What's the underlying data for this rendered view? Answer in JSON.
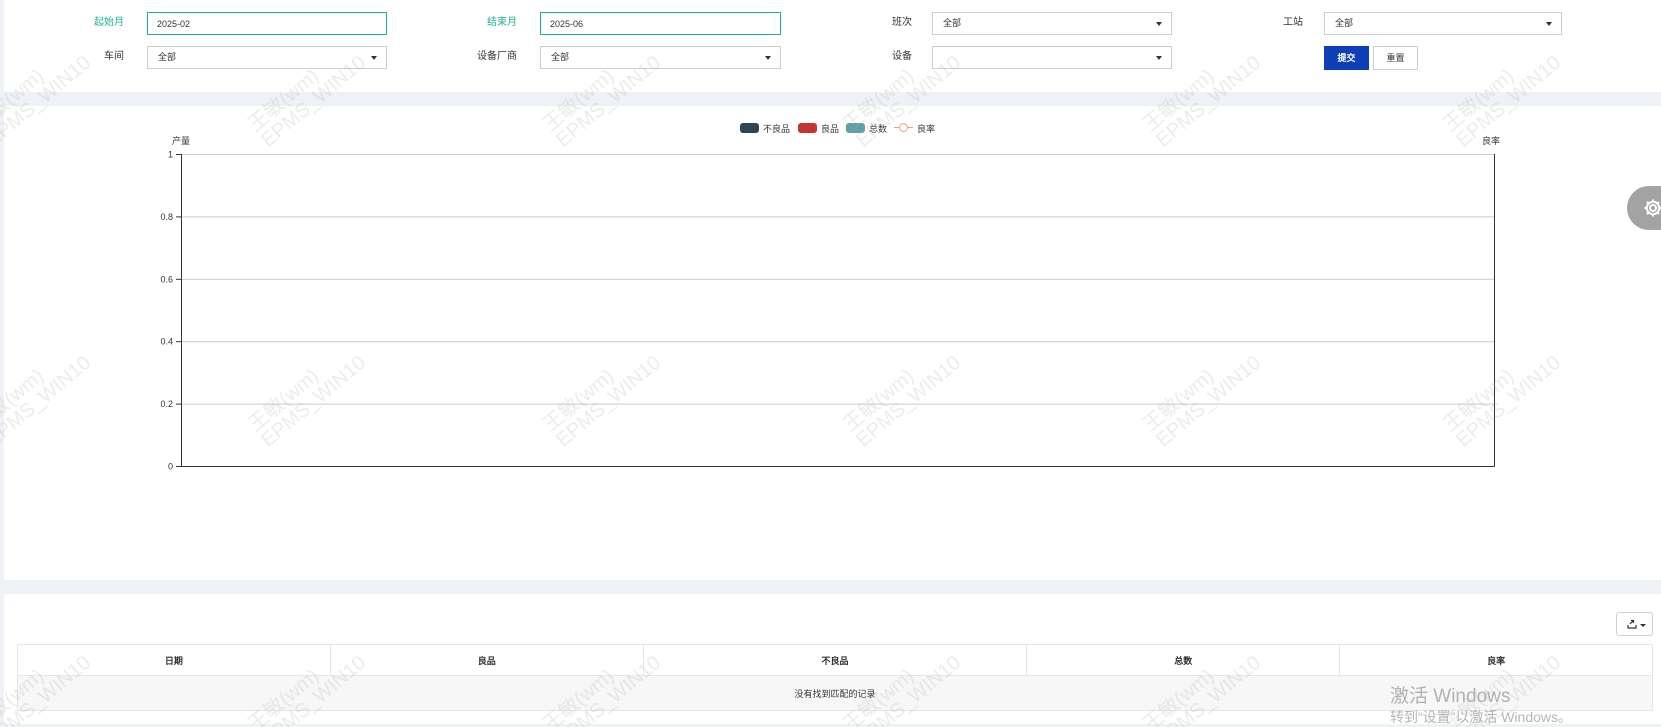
{
  "filters": {
    "start_month": {
      "label": "起始月",
      "value": "2025-02"
    },
    "end_month": {
      "label": "结束月",
      "value": "2025-06"
    },
    "shift": {
      "label": "班次",
      "value": "全部"
    },
    "station": {
      "label": "工站",
      "value": "全部"
    },
    "workshop": {
      "label": "车间",
      "value": "全部"
    },
    "vendor": {
      "label": "设备厂商",
      "value": "全部"
    },
    "equipment": {
      "label": "设备",
      "value": ""
    },
    "submit_label": "提交",
    "reset_label": "重置"
  },
  "colors": {
    "accent": "#1bb394",
    "primary_button": "#0d3fb6",
    "defective": "#2f4554",
    "good": "#c23531",
    "total": "#61a0a8",
    "yield_rate": "#e6a57a"
  },
  "chart_data": {
    "type": "bar",
    "title": "",
    "categories": [],
    "series": [
      {
        "name": "不良品",
        "type": "bar",
        "values": []
      },
      {
        "name": "良品",
        "type": "bar",
        "values": []
      },
      {
        "name": "总数",
        "type": "bar",
        "values": []
      },
      {
        "name": "良率",
        "type": "line",
        "values": []
      }
    ],
    "ylabel": "产量",
    "y2label": "良率",
    "ylim": [
      0,
      1
    ],
    "yticks": [
      "1",
      "0.8",
      "0.6",
      "0.4",
      "0.2",
      "0"
    ],
    "grid": true,
    "legend_position": "top-center"
  },
  "table": {
    "export_icon": "export-icon",
    "columns": [
      "日期",
      "良品",
      "不良品",
      "总数",
      "良率"
    ],
    "rows": [],
    "empty_text": "没有找到匹配的记录"
  },
  "settings_icon": "gear-icon",
  "watermark": {
    "line1": "王敏(wm)",
    "line2": "EPMS_WIN10"
  },
  "activation": {
    "title": "激活 Windows",
    "subtitle": "转到“设置”以激活 Windows。"
  }
}
